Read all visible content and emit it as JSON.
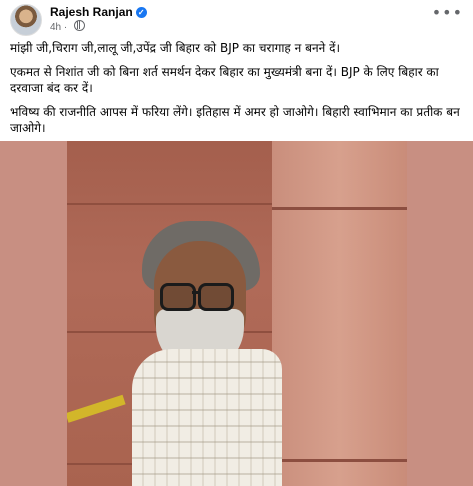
{
  "post": {
    "author": "Rajesh Ranjan",
    "verified_icon": "verified-badge-icon",
    "time": "4h",
    "privacy_icon": "globe-icon",
    "more_icon": "more-options-icon",
    "paragraphs": [
      "मांझी जी,चिराग जी,लालू जी,उपेंद्र जी बिहार को BJP का चरागाह न बनने दें।",
      "एकमत से निशांत जी को बिना शर्त समर्थन देकर बिहार का मुख्यमंत्री बना दें। BJP के लिए बिहार का दरवाजा बंद कर दें।",
      "भविष्य की राजनीति आपस में फरिया लेंगे। इतिहास में अमर हो जाओगे। बिहारी स्वाभिमान का प्रतीक बन जाओगे।"
    ]
  },
  "colors": {
    "verified_blue": "#1877f2",
    "meta_gray": "#65676b",
    "photo_bg": "#c88f82"
  }
}
